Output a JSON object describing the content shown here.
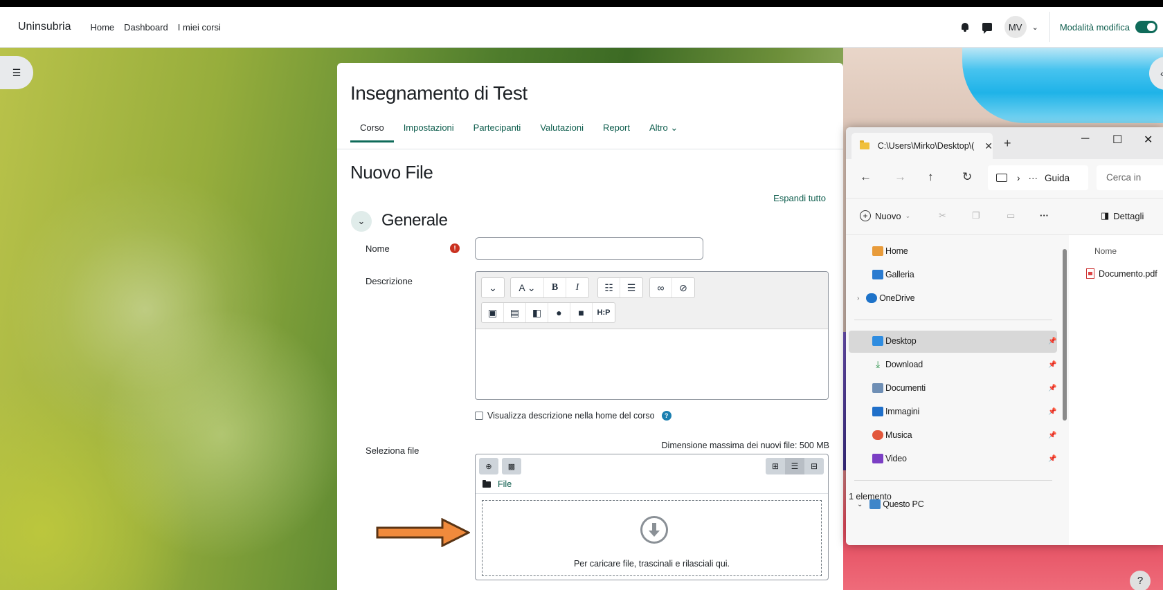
{
  "navbar": {
    "brand": "Uninsubria",
    "links": [
      "Home",
      "Dashboard",
      "I miei corsi"
    ],
    "avatar_initials": "MV",
    "edit_mode_label": "Modalità modifica",
    "edit_mode_on": true
  },
  "course": {
    "title": "Insegnamento di Test",
    "tabs": [
      "Corso",
      "Impostazioni",
      "Partecipanti",
      "Valutazioni",
      "Report",
      "Altro"
    ],
    "active_tab": "Corso"
  },
  "form": {
    "page_title": "Nuovo File",
    "expand_all": "Espandi tutto",
    "section_title": "Generale",
    "name_label": "Nome",
    "name_value": "",
    "description_label": "Descrizione",
    "show_description_label": "Visualizza descrizione nella home del corso",
    "select_file_label": "Seleziona file",
    "max_size_text": "Dimensione massima dei nuovi file: 500 MB",
    "file_path_label": "File",
    "dropzone_text": "Per caricare file, trascinali e rilasciali qui."
  },
  "editor": {
    "row1": [
      "⌄",
      "A⌄",
      "B",
      "I",
      "☰",
      "≡",
      "⊘",
      "⊗"
    ],
    "h5p_label": "H:P"
  },
  "explorer": {
    "tab_title": "C:\\Users\\Mirko\\Desktop\\(",
    "address_crumb": "Guida",
    "search_placeholder": "Cerca in",
    "new_label": "Nuovo",
    "details_label": "Dettagli",
    "nav_items": [
      {
        "label": "Home",
        "icon": "home-icon"
      },
      {
        "label": "Galleria",
        "icon": "gallery-icon"
      },
      {
        "label": "OneDrive",
        "icon": "cloud-icon"
      },
      {
        "label": "Desktop",
        "icon": "desktop-icon"
      },
      {
        "label": "Download",
        "icon": "download-icon"
      },
      {
        "label": "Documenti",
        "icon": "documents-icon"
      },
      {
        "label": "Immagini",
        "icon": "pictures-icon"
      },
      {
        "label": "Musica",
        "icon": "music-icon"
      },
      {
        "label": "Video",
        "icon": "video-icon"
      },
      {
        "label": "Questo PC",
        "icon": "pc-icon"
      }
    ],
    "column_name": "Nome",
    "file_name": "Documento.pdf",
    "status": "1 elemento"
  },
  "colors": {
    "brand_green": "#0f6b5a",
    "link_green": "#0c5c4c",
    "required_red": "#ca3120",
    "arrow_orange": "#f08a3c"
  }
}
